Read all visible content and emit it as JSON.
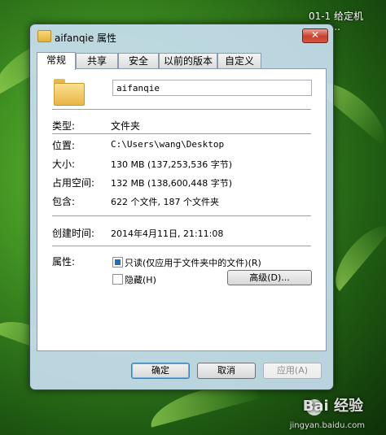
{
  "desktop": {
    "icon_label_line1": "01-1 给定机",
    "icon_label_line2": "...",
    "watermark": "Bai 经验",
    "watermark_url": "jingyan.baidu.com"
  },
  "dialog": {
    "title": "aifanqie 属性",
    "close_glyph": "✕",
    "tabs": [
      "常规",
      "共享",
      "安全",
      "以前的版本",
      "自定义"
    ],
    "active_tab": "常规",
    "name_value": "aifanqie",
    "rows": {
      "type": {
        "label": "类型:",
        "value": "文件夹"
      },
      "location": {
        "label": "位置:",
        "value": "C:\\Users\\wang\\Desktop"
      },
      "size": {
        "label": "大小:",
        "value": "130 MB (137,253,536 字节)"
      },
      "size_on_disk": {
        "label": "占用空间:",
        "value": "132 MB (138,600,448 字节)"
      },
      "contains": {
        "label": "包含:",
        "value": "622 个文件, 187 个文件夹"
      },
      "created": {
        "label": "创建时间:",
        "value": "2014年4月11日, 21:11:08"
      },
      "attributes": {
        "label": "属性:"
      }
    },
    "attributes": {
      "readonly_label": "只读(仅应用于文件夹中的文件)(R)",
      "readonly_checked": true,
      "hidden_label": "隐藏(H)",
      "hidden_checked": false,
      "advanced_button": "高级(D)..."
    },
    "buttons": {
      "ok": "确定",
      "cancel": "取消",
      "apply": "应用(A)"
    }
  },
  "colors": {
    "checkbox_fill": "#1f6fbf",
    "close_button": "#c7402c"
  }
}
